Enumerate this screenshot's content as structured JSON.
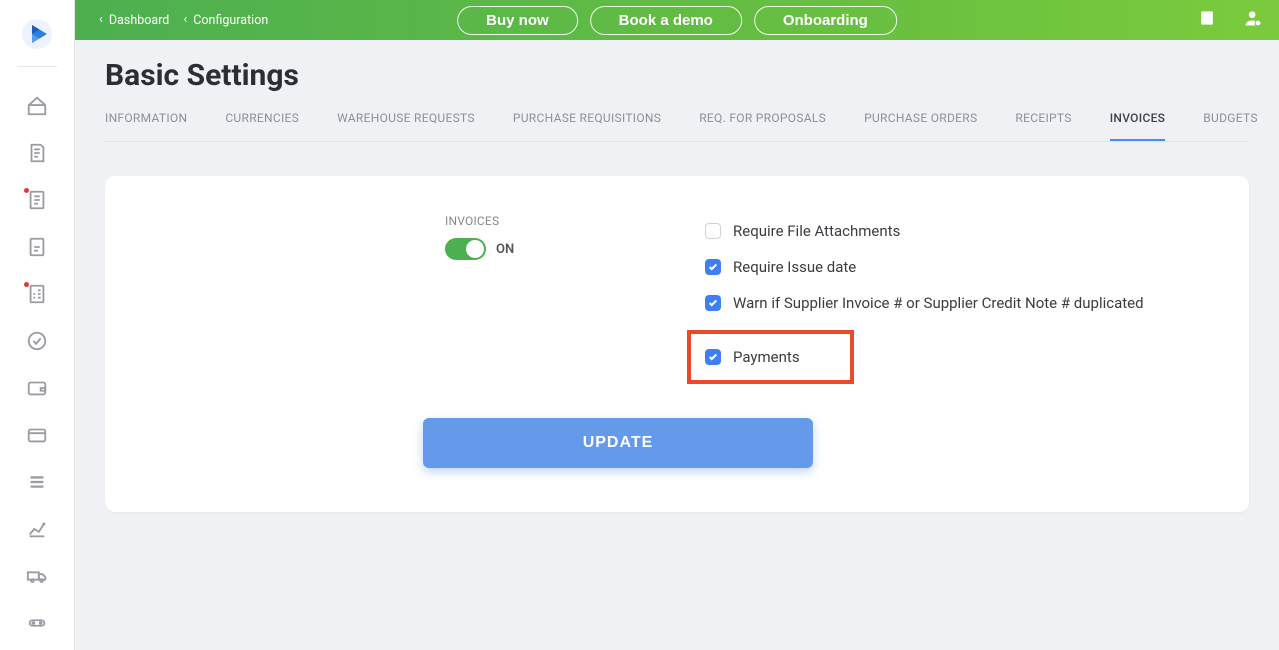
{
  "sidebar": {
    "items": [
      {
        "name": "home-icon"
      },
      {
        "name": "doc-request-icon"
      },
      {
        "name": "doc-list-icon",
        "dot": true
      },
      {
        "name": "doc-plain-icon"
      },
      {
        "name": "doc-check-icon",
        "dot": true
      },
      {
        "name": "approve-icon"
      },
      {
        "name": "wallet-icon"
      },
      {
        "name": "card-icon"
      },
      {
        "name": "lines-icon"
      },
      {
        "name": "chart-icon"
      },
      {
        "name": "truck-icon"
      },
      {
        "name": "server-icon"
      }
    ]
  },
  "topbar": {
    "crumbs": [
      {
        "label": "Dashboard"
      },
      {
        "label": "Configuration"
      }
    ],
    "buttons": {
      "buy": "Buy now",
      "demo": "Book a demo",
      "onboard": "Onboarding"
    }
  },
  "page": {
    "title": "Basic Settings",
    "tabs": [
      "INFORMATION",
      "CURRENCIES",
      "WAREHOUSE REQUESTS",
      "PURCHASE REQUISITIONS",
      "REQ. FOR PROPOSALS",
      "PURCHASE ORDERS",
      "RECEIPTS",
      "INVOICES",
      "BUDGETS"
    ],
    "active_tab": 7
  },
  "invoices_panel": {
    "section_label": "INVOICES",
    "toggle_state": "ON",
    "checks": {
      "require_attachments": {
        "label": "Require File Attachments",
        "checked": false
      },
      "require_issue_date": {
        "label": "Require Issue date",
        "checked": true
      },
      "warn_duplicate": {
        "label": "Warn if Supplier Invoice # or Supplier Credit Note # duplicated",
        "checked": true
      },
      "payments": {
        "label": "Payments",
        "checked": true
      }
    },
    "update_label": "UPDATE"
  }
}
